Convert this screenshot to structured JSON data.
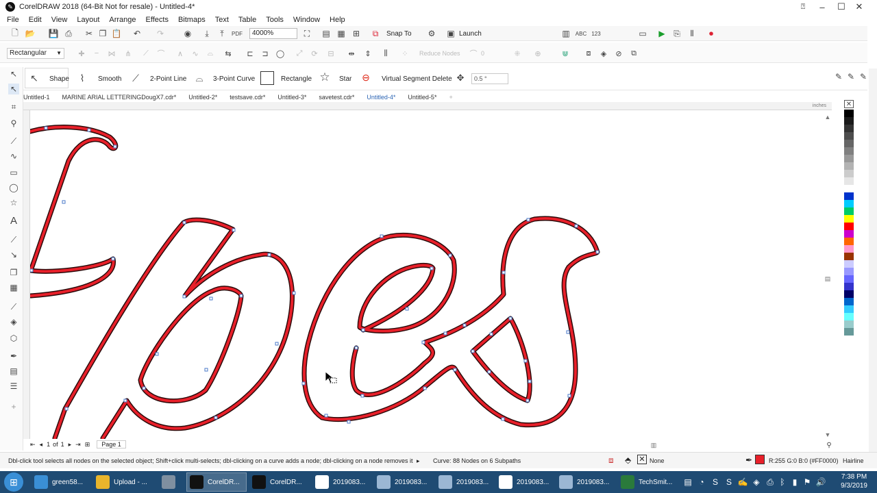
{
  "window": {
    "title": "CorelDRAW 2018 (64-Bit Not for resale) - Untitled-4*"
  },
  "menu": [
    "File",
    "Edit",
    "View",
    "Layout",
    "Arrange",
    "Effects",
    "Bitmaps",
    "Text",
    "Table",
    "Tools",
    "Window",
    "Help"
  ],
  "toolbar": {
    "zoom": "4000%",
    "snap_to": "Snap To",
    "launch": "Launch"
  },
  "property_bar": {
    "selection_mode": "Rectangular",
    "reduce_nodes": "Reduce Nodes",
    "node_count": "0"
  },
  "shape_bar": {
    "shape": "Shape",
    "smooth": "Smooth",
    "two_point_line": "2-Point Line",
    "three_point_curve": "3-Point Curve",
    "rectangle": "Rectangle",
    "star": "Star",
    "virtual_segment_delete": "Virtual Segment Delete",
    "angle": "0.5 °"
  },
  "tabs": [
    "Untitled-1",
    "MARINE ARIAL LETTERINGDougX7.cdr*",
    "Untitled-2*",
    "testsave.cdr*",
    "Untitled-3*",
    "savetest.cdr*",
    "Untitled-4*",
    "Untitled-5*"
  ],
  "active_tab": "Untitled-4*",
  "ruler_unit": "inches",
  "page_nav": {
    "current": "1",
    "of": "of",
    "total": "1",
    "page_label": "Page 1"
  },
  "status": {
    "hint": "Dbl-click tool selects all nodes on the selected object; Shift+click multi-selects; dbl-clicking on a curve adds a node; dbl-clicking on a node removes it",
    "curve_info": "Curve: 88 Nodes on 6 Subpaths",
    "fill": "None",
    "outline_color": "R:255 G:0 B:0 (#FF0000)",
    "outline_width": "Hairline"
  },
  "palette": [
    "#000000",
    "#1a1a1a",
    "#333333",
    "#4d4d4d",
    "#666666",
    "#808080",
    "#999999",
    "#b3b3b3",
    "#cccccc",
    "#e6e6e6",
    "#ffffff",
    "#0033cc",
    "#00ccff",
    "#00cc66",
    "#ffff00",
    "#ff0000",
    "#cc00cc",
    "#ff6600",
    "#ff99cc",
    "#993300",
    "#ccccff",
    "#9999ff",
    "#6666ff",
    "#3333cc",
    "#000066",
    "#0066cc",
    "#33ccff",
    "#66ffff",
    "#99cccc",
    "#669999"
  ],
  "colors": {
    "outline": "#e8202a",
    "taskbar": "#1f4b73"
  },
  "taskbar": {
    "items": [
      {
        "label": "green58...",
        "icon": "ie-icon",
        "color": "#3a8fd6"
      },
      {
        "label": "Upload - ...",
        "icon": "chrome-icon",
        "color": "#e9b52c"
      },
      {
        "label": "",
        "icon": "tool-icon",
        "color": "#7f8fa0"
      },
      {
        "label": "CorelDR...",
        "icon": "coreldraw-icon",
        "color": "#111111"
      },
      {
        "label": "CorelDR...",
        "icon": "coreldraw-icon",
        "color": "#111111"
      },
      {
        "label": "2019083...",
        "icon": "calendar-icon",
        "color": "#ffffff"
      },
      {
        "label": "2019083...",
        "icon": "image-icon",
        "color": "#9bb7d4"
      },
      {
        "label": "2019083...",
        "icon": "image-icon",
        "color": "#9bb7d4"
      },
      {
        "label": "2019083...",
        "icon": "calendar-icon",
        "color": "#ffffff"
      },
      {
        "label": "2019083...",
        "icon": "image-icon",
        "color": "#9bb7d4"
      },
      {
        "label": "TechSmit...",
        "icon": "snagit-icon",
        "color": "#2a7a3b"
      }
    ],
    "time": "7:38 PM",
    "date": "9/3/2019"
  }
}
